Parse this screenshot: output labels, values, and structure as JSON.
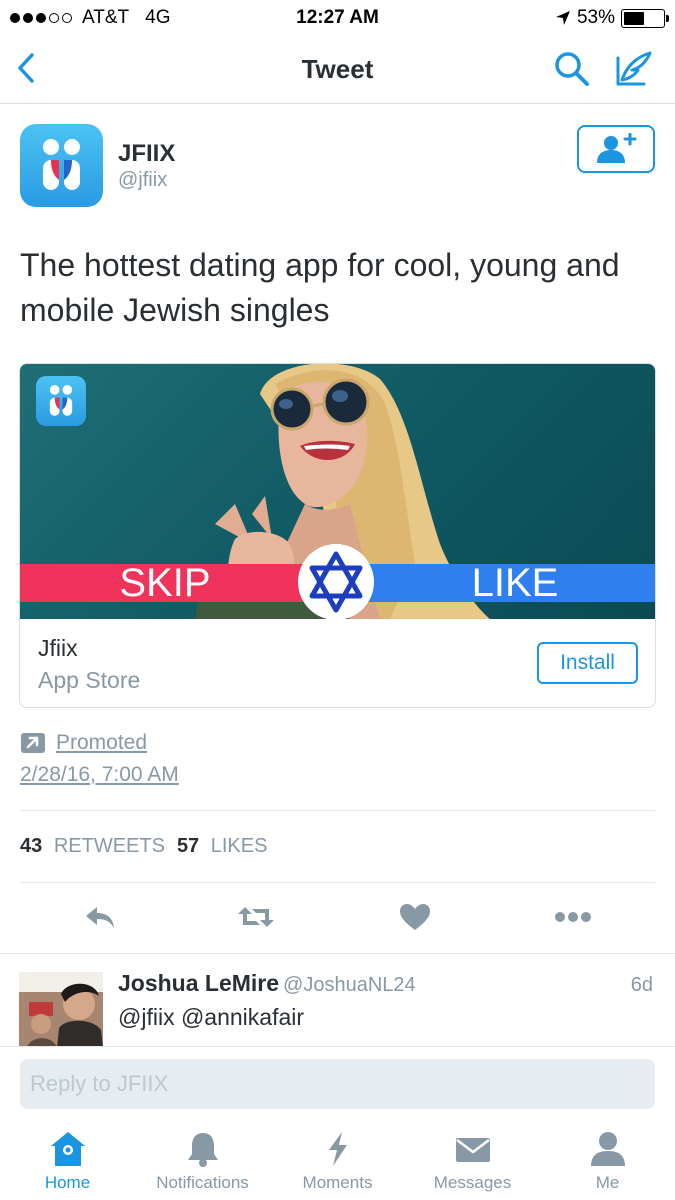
{
  "status_bar": {
    "carrier": "AT&T",
    "network": "4G",
    "time": "12:27 AM",
    "battery_percent": "53%",
    "battery_level": 0.53,
    "signal_bars": 3
  },
  "nav": {
    "title": "Tweet",
    "back_icon": "chevron-left-icon",
    "search_icon": "search-icon",
    "compose_icon": "compose-icon"
  },
  "tweet": {
    "display_name": "JFIIX",
    "handle": "@jfiix",
    "text": "The hottest dating app for cool, young and mobile Jewish singles",
    "card": {
      "skip_label": "SKIP",
      "like_label": "LIKE",
      "app_name": "Jfiix",
      "store": "App Store",
      "install_label": "Install"
    },
    "promoted_label": "Promoted",
    "timestamp": "2/28/16, 7:00 AM",
    "retweets_count": "43",
    "retweets_label": "RETWEETS",
    "likes_count": "57",
    "likes_label": "LIKES"
  },
  "reply": {
    "display_name": "Joshua LeMire",
    "handle": "@JoshuaNL24",
    "time": "6d",
    "text": "@jfiix @annikafair"
  },
  "composer": {
    "placeholder": "Reply to JFIIX"
  },
  "tabs": [
    {
      "label": "Home",
      "icon": "home-icon",
      "active": true
    },
    {
      "label": "Notifications",
      "icon": "bell-icon",
      "active": false
    },
    {
      "label": "Moments",
      "icon": "lightning-icon",
      "active": false
    },
    {
      "label": "Messages",
      "icon": "envelope-icon",
      "active": false
    },
    {
      "label": "Me",
      "icon": "person-icon",
      "active": false
    }
  ],
  "colors": {
    "accent": "#1b95e0",
    "muted": "#8899a6",
    "text": "#292f33",
    "skip_red": "#f0335b",
    "like_blue": "#2f7ff0"
  }
}
